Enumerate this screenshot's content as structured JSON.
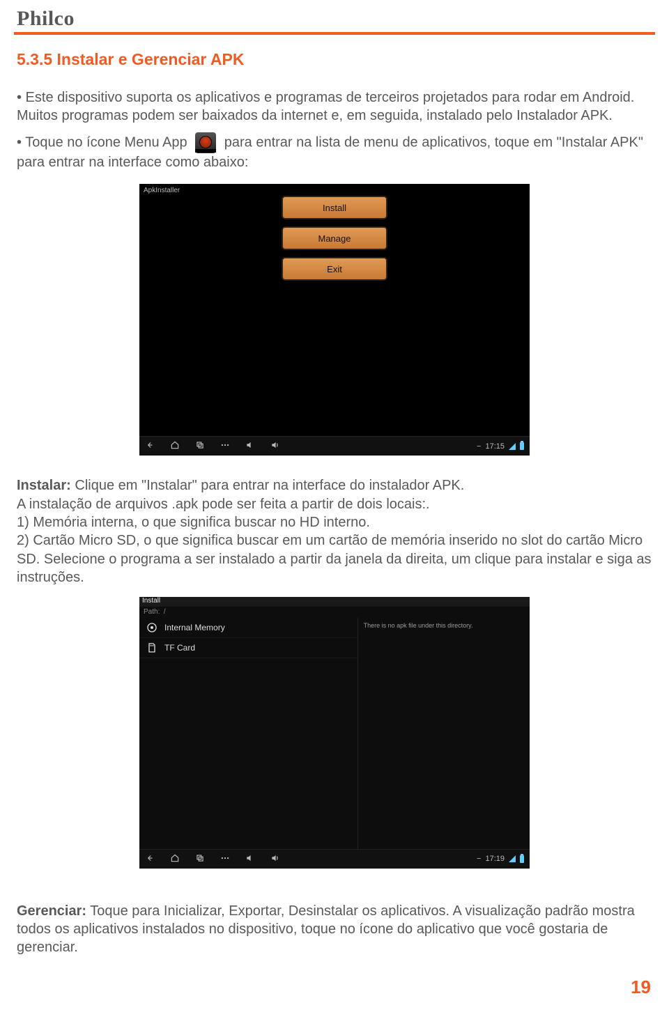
{
  "brand": "Philco",
  "section_title": "5.3.5 Instalar e Gerenciar APK",
  "para1": "• Este dispositivo suporta os aplicativos e programas de terceiros projetados para rodar em Android. Muitos programas podem ser baixados da internet e, em seguida, instalado pelo Instalador APK.",
  "para2a": "• Toque no ícone Menu App",
  "para2b": "para entrar na lista de menu de aplicativos, toque em \"Instalar APK\" para entrar na interface como abaixo:",
  "shot1": {
    "title": "ApkInstaller",
    "buttons": {
      "install": "Install",
      "manage": "Manage",
      "exit": "Exit"
    },
    "clock": "17:15",
    "navminus": "−"
  },
  "instalar_label": "Instalar:",
  "instalar_text": " Clique em \"Instalar\" para entrar na interface do instalador APK.",
  "instalar_p2": "A instalação de arquivos .apk pode ser feita a partir de dois locais:.",
  "instalar_p3": "1) Memória interna, o que significa buscar no HD interno.",
  "instalar_p4": "2) Cartão Micro SD, o que significa buscar em um cartão de memória inserido no slot do cartão Micro SD. Selecione o programa a ser instalado a partir da janela da direita, um clique para instalar e siga as instruções.",
  "shot2": {
    "title": "Install",
    "path_label": "Path:",
    "path_value": "/",
    "rows": {
      "r0": "Internal Memory",
      "r1": "TF Card"
    },
    "right_msg": "There is no apk file under this directory.",
    "clock": "17:19"
  },
  "gerenciar_label": "Gerenciar:",
  "gerenciar_text": " Toque para Inicializar, Exportar, Desinstalar os aplicativos. A visualização padrão mostra todos os aplicativos instalados no dispositivo, toque no ícone do aplicativo que você gostaria de gerenciar.",
  "page_number": "19"
}
